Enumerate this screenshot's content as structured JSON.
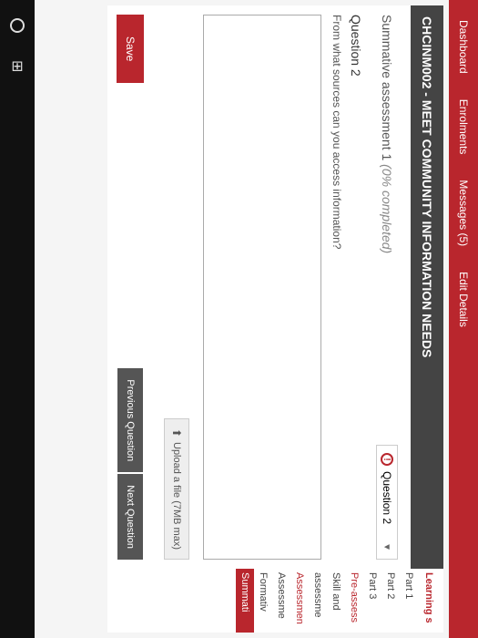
{
  "topnav": {
    "items": [
      "Dashboard",
      "Enrolments",
      "Messages (5)",
      "Edit Details"
    ]
  },
  "course": {
    "header": "CHCINM002 - MEET COMMUNITY INFORMATION NEEDS"
  },
  "assessment": {
    "title": "Summative assessment 1 ",
    "completed": "(0% completed)",
    "dropdown_label": "Question 2"
  },
  "question": {
    "label": "Question 2",
    "text": "From what sources can you access information?",
    "answer": ""
  },
  "upload": {
    "label": "Upload a file (7MB max)"
  },
  "buttons": {
    "save": "Save",
    "prev": "Previous Question",
    "next": "Next Question"
  },
  "sidebar": {
    "heading": "Learning s",
    "items": [
      {
        "label": "Part 1",
        "red": false
      },
      {
        "label": "Part 2",
        "red": false
      },
      {
        "label": "Part 3",
        "red": false
      },
      {
        "label": "Pre-assess",
        "red": true
      },
      {
        "label": "Skill and",
        "red": false
      },
      {
        "label": "assessme",
        "red": false
      },
      {
        "label": "Assessmen",
        "red": true
      },
      {
        "label": "Assessme",
        "red": false
      },
      {
        "label": "Formativ",
        "red": false
      }
    ],
    "active": "Summati"
  }
}
